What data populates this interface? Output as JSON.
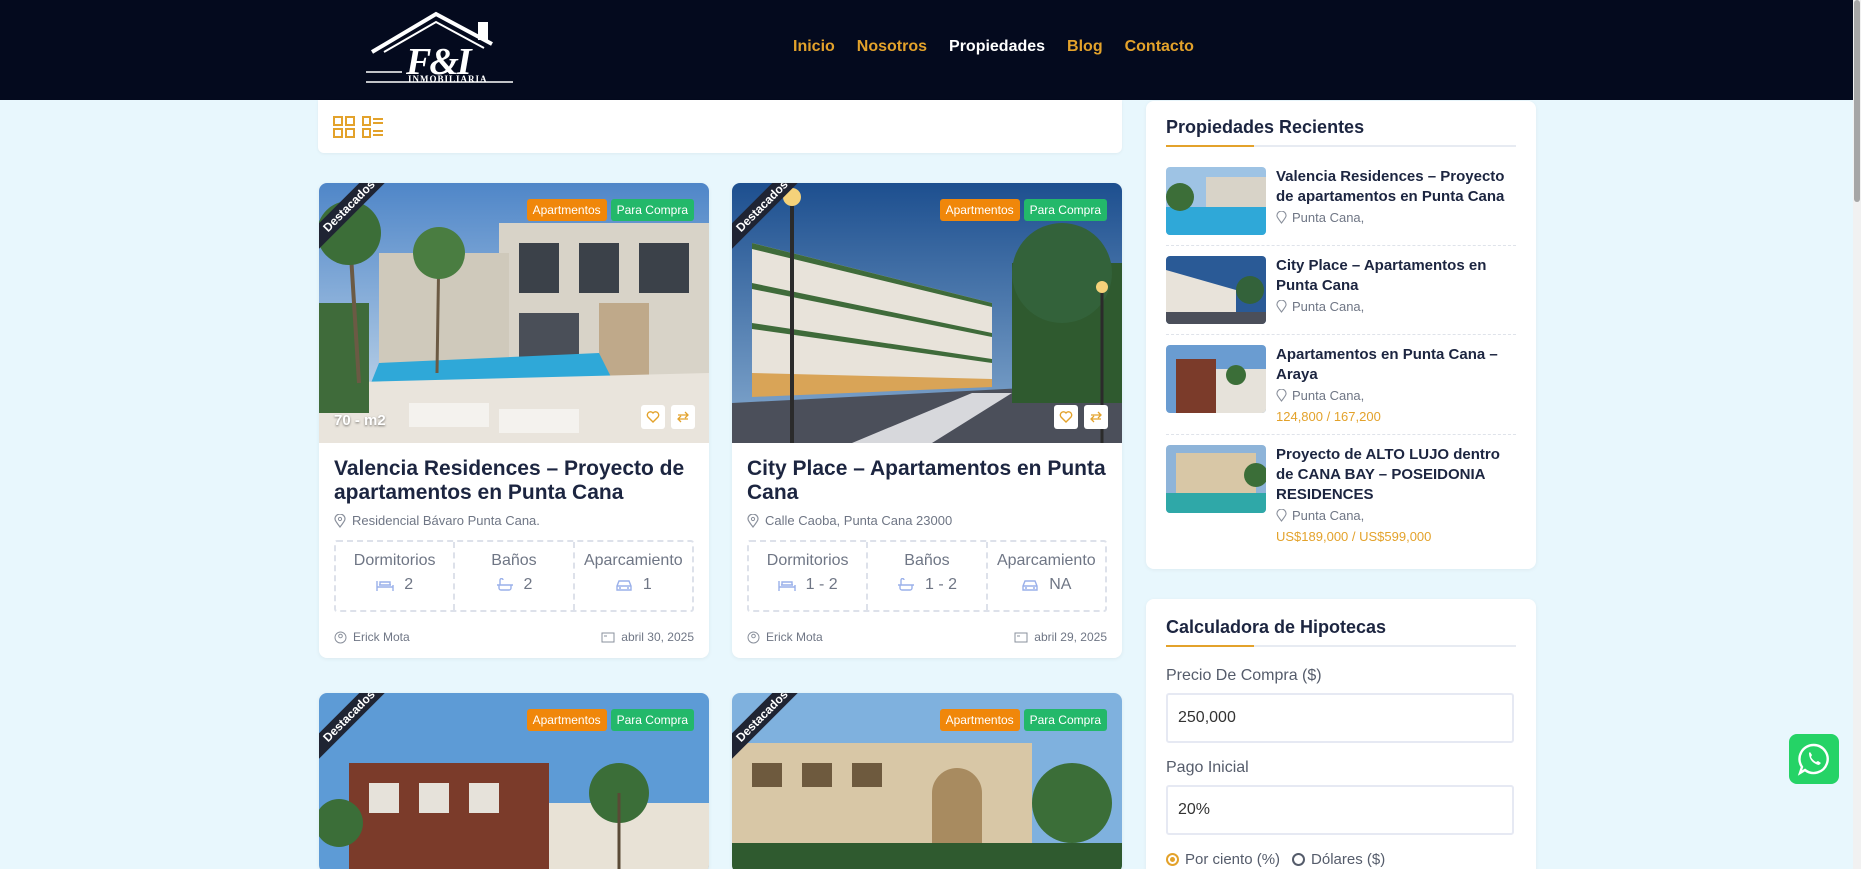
{
  "brand": {
    "logo_text": "F&I",
    "logo_subtitle": "INMOBILIARIA"
  },
  "nav": [
    {
      "label": "Inicio"
    },
    {
      "label": "Nosotros"
    },
    {
      "label": "Propiedades"
    },
    {
      "label": "Blog"
    },
    {
      "label": "Contacto"
    }
  ],
  "nav_active_index": 2,
  "view_modes": [
    "grid-icon",
    "list-icon"
  ],
  "cards": [
    {
      "ribbon": "Destacados",
      "tags": [
        "Apartmentos",
        "Para Compra"
      ],
      "area": "70 - m2",
      "title": "Valencia Residences – Proyecto de apartamentos en Punta Cana",
      "address": "Residencial Bávaro Punta Cana.",
      "specs": [
        {
          "label": "Dormitorios",
          "value": "2",
          "icon": "bed-icon"
        },
        {
          "label": "Baños",
          "value": "2",
          "icon": "bathtub-icon"
        },
        {
          "label": "Aparcamiento",
          "value": "1",
          "icon": "car-icon"
        }
      ],
      "author": "Erick Mota",
      "date": "abril 30, 2025"
    },
    {
      "ribbon": "Destacados",
      "tags": [
        "Apartmentos",
        "Para Compra"
      ],
      "area": "",
      "title": "City Place – Apartamentos en Punta Cana",
      "address": "Calle Caoba, Punta Cana 23000",
      "specs": [
        {
          "label": "Dormitorios",
          "value": "1 - 2",
          "icon": "bed-icon"
        },
        {
          "label": "Baños",
          "value": "1 - 2",
          "icon": "bathtub-icon"
        },
        {
          "label": "Aparcamiento",
          "value": "NA",
          "icon": "car-icon"
        }
      ],
      "author": "Erick Mota",
      "date": "abril 29, 2025"
    },
    {
      "ribbon": "Destacados",
      "tags": [
        "Apartmentos",
        "Para Compra"
      ]
    },
    {
      "ribbon": "Destacados",
      "tags": [
        "Apartmentos",
        "Para Compra"
      ]
    }
  ],
  "recent": {
    "title": "Propiedades Recientes",
    "items": [
      {
        "title": "Valencia Residences – Proyecto de apartamentos en Punta Cana",
        "location": "Punta Cana,",
        "price": ""
      },
      {
        "title": "City Place – Apartamentos en Punta Cana",
        "location": "Punta Cana,",
        "price": ""
      },
      {
        "title": "Apartamentos en Punta Cana – Araya",
        "location": "Punta Cana,",
        "price": "124,800 / 167,200"
      },
      {
        "title": "Proyecto de ALTO LUJO dentro de CANA BAY – POSEIDONIA RESIDENCES",
        "location": "Punta Cana,",
        "price": "US$189,000 / US$599,000"
      }
    ]
  },
  "calculator": {
    "title": "Calculadora de Hipotecas",
    "price_label": "Precio De Compra ($)",
    "price_value": "250,000",
    "down_label": "Pago Inicial",
    "down_value": "20%",
    "radio_percent": "Por ciento (%)",
    "radio_dollars": "Dólares ($)",
    "selected": "percent"
  },
  "colors": {
    "accent": "#e3a22b",
    "header_bg": "#040a1e",
    "page_bg": "#e8f7fd",
    "tag_orange": "#f0870a",
    "tag_green": "#23b86a",
    "whatsapp": "#25d366"
  }
}
